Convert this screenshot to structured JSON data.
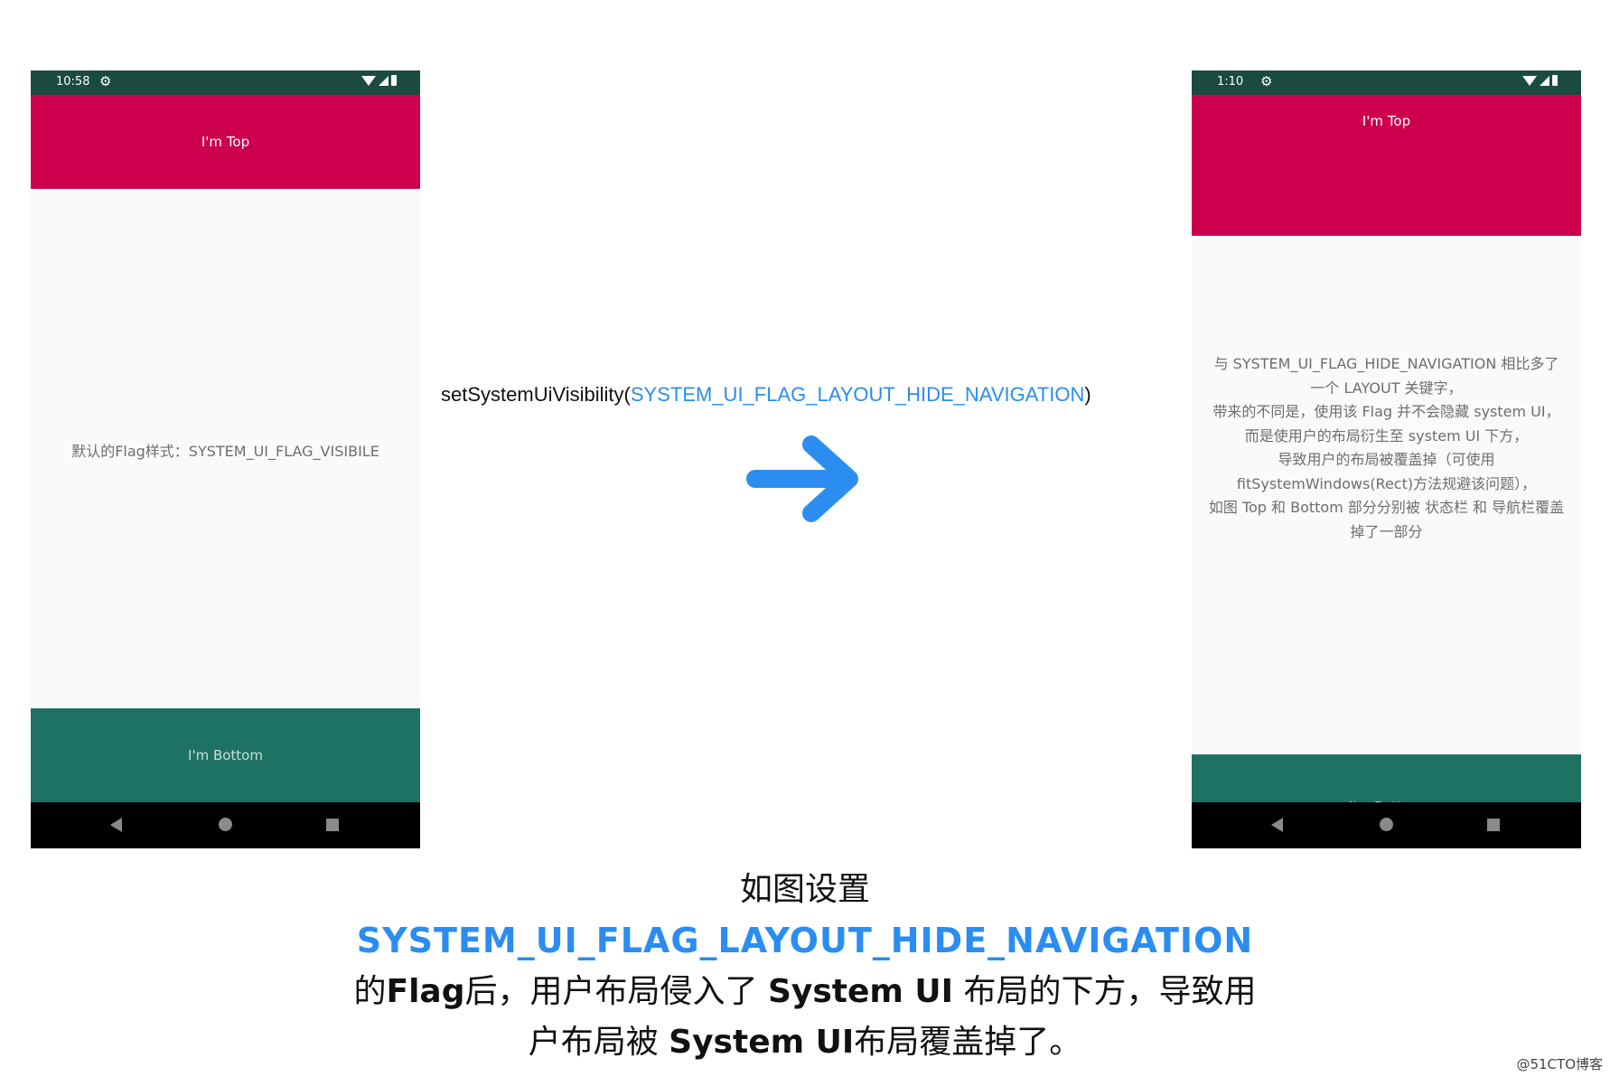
{
  "phone_left": {
    "status_time": "10:58",
    "top_label": "I'm Top",
    "center_text": "默认的Flag样式：SYSTEM_UI_FLAG_VISIBILE",
    "bottom_label": "I'm Bottom"
  },
  "phone_right": {
    "status_time": "1:10",
    "top_label": "I'm Top",
    "center_lines": [
      "与 SYSTEM_UI_FLAG_HIDE_NAVIGATION 相比多了一个 LAYOUT 关键字，",
      "带来的不同是，使用该 Flag 并不会隐藏 system UI，",
      "而是使用户的布局衍生至 system UI 下方，",
      "导致用户的布局被覆盖掉（可使用 fitSystemWindows(Rect)方法规避该问题），",
      "如图 Top 和 Bottom 部分分别被 状态栏 和 导航栏覆盖掉了一部分"
    ],
    "bottom_label": "I'm Bottom"
  },
  "api_call": {
    "method": "setSystemUiVisibility(",
    "flag": "SYSTEM_UI_FLAG_LAYOUT_HIDE_NAVIGATION",
    "close": ")"
  },
  "caption": {
    "line1": "如图设置",
    "line2": "SYSTEM_UI_FLAG_LAYOUT_HIDE_NAVIGATION",
    "line3_a": "的",
    "line3_b": "Flag",
    "line3_c": "后，用户布局侵入了 ",
    "line3_d": "System UI",
    "line3_e": " 布局的下方，导致用",
    "line4_a": "户布局被 ",
    "line4_b": "System UI",
    "line4_c": "布局覆盖掉了。"
  },
  "watermark": "@51CTO博客",
  "colors": {
    "top_bar": "#cc004d",
    "bottom_bar": "#1d7263",
    "status_bar": "#1b4a40",
    "accent": "#2b8df0"
  },
  "icons": {
    "status_gear": "gear-icon",
    "arrow": "arrow-right-icon"
  }
}
